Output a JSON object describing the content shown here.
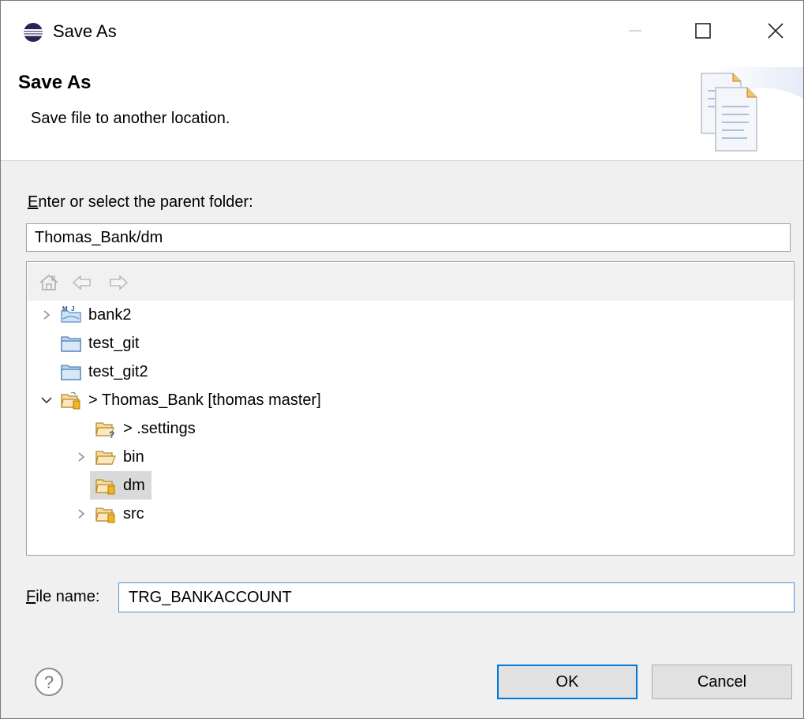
{
  "window": {
    "title": "Save As"
  },
  "banner": {
    "title": "Save As",
    "description": "Save file to another location."
  },
  "folder": {
    "label_prefix": "",
    "label_mnemonic": "E",
    "label_rest": "nter or select the parent folder:",
    "value": "Thomas_Bank/dm"
  },
  "tree": {
    "toolbar": [
      "home-icon",
      "back-arrow-icon",
      "forward-arrow-icon"
    ],
    "items": [
      {
        "label": "bank2",
        "icon": "maven-project-icon",
        "expandable": true,
        "expanded": false,
        "level": 0
      },
      {
        "label": "test_git",
        "icon": "closed-folder-icon",
        "expandable": false,
        "level": 0
      },
      {
        "label": "test_git2",
        "icon": "closed-folder-icon",
        "expandable": false,
        "level": 0
      },
      {
        "label": "> Thomas_Bank [thomas master]",
        "icon": "git-project-icon",
        "expandable": true,
        "expanded": true,
        "level": 0
      },
      {
        "label": "> .settings",
        "icon": "untracked-folder-icon",
        "expandable": false,
        "level": 1
      },
      {
        "label": "bin",
        "icon": "open-folder-icon",
        "expandable": true,
        "expanded": false,
        "level": 1
      },
      {
        "label": "dm",
        "icon": "tracked-folder-icon",
        "expandable": false,
        "level": 1,
        "selected": true
      },
      {
        "label": "src",
        "icon": "tracked-folder-icon",
        "expandable": true,
        "expanded": false,
        "level": 1
      }
    ]
  },
  "file": {
    "label_mnemonic": "F",
    "label_rest": "ile name:",
    "value": "TRG_BANKACCOUNT"
  },
  "buttons": {
    "ok": "OK",
    "cancel": "Cancel"
  },
  "colors": {
    "accent": "#0078d7",
    "selection": "#d9d9d9",
    "folder_yellow": "#f4c542",
    "folder_blue": "#9cc3e6"
  }
}
